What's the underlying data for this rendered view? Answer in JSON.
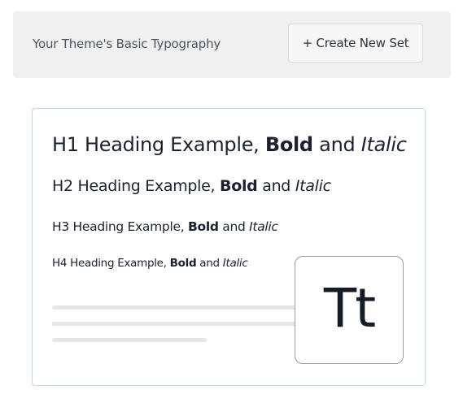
{
  "header": {
    "title": "Your Theme's Basic Typography",
    "create_button_label": "+ Create New Set"
  },
  "typography_card": {
    "headings": [
      {
        "prefix": "H1 Heading Example, ",
        "bold": "Bold",
        "middle": " and ",
        "italic": "Italic"
      },
      {
        "prefix": "H2 Heading Example, ",
        "bold": "Bold",
        "middle": " and ",
        "italic": "Italic"
      },
      {
        "prefix": "H3 Heading Example, ",
        "bold": "Bold",
        "middle": " and ",
        "italic": "Italic"
      },
      {
        "prefix": "H4 Heading Example, ",
        "bold": "Bold",
        "middle": " and ",
        "italic": "Italic"
      }
    ],
    "preview_glyph": "Tt"
  },
  "colors": {
    "header_bg": "#f0f0f0",
    "card_border": "#bcd9e4",
    "text_dark": "#1a2230",
    "placeholder_line": "#e6e6e6"
  }
}
